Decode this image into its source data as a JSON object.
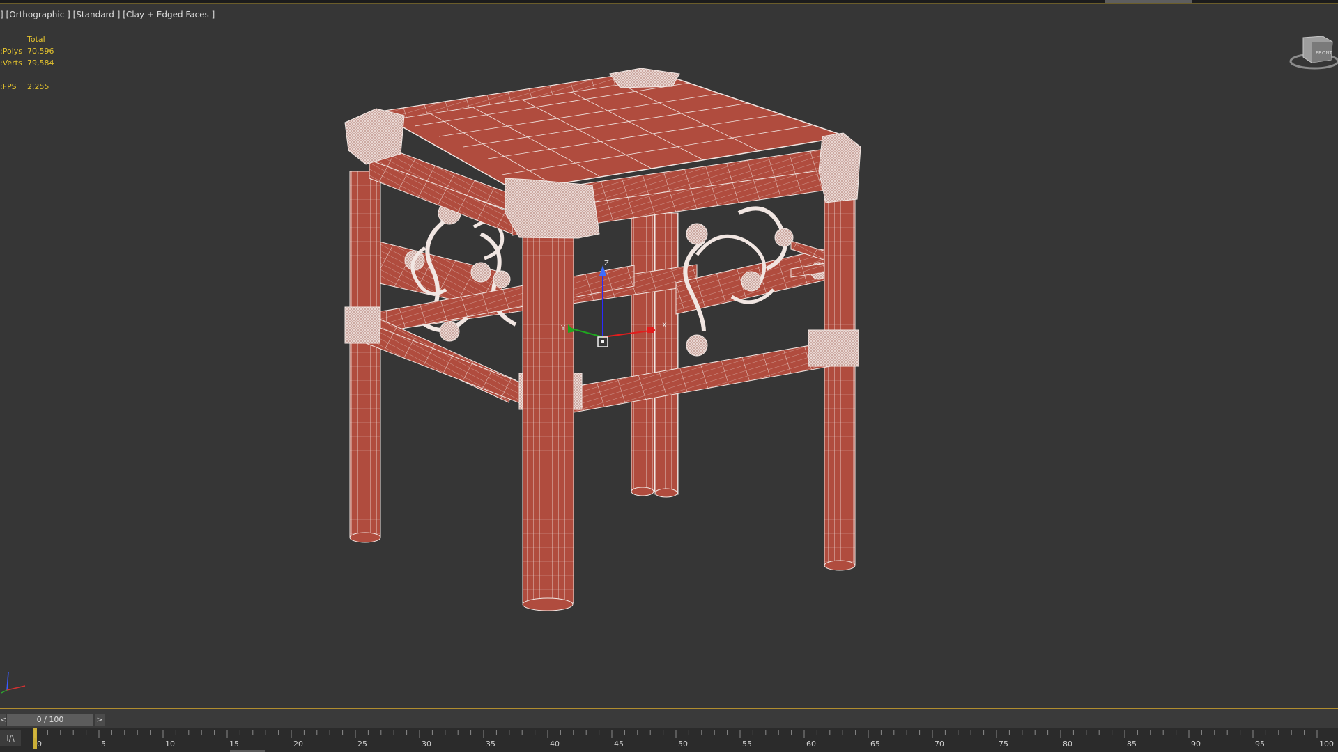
{
  "viewport": {
    "label_parts": [
      "]",
      "[Orthographic ]",
      "[Standard ]",
      "[Clay + Edged Faces ]"
    ],
    "stats": {
      "header": "Total",
      "rows": [
        {
          "key": "Polys:",
          "value": "70,596"
        },
        {
          "key": "Verts:",
          "value": "79,584"
        }
      ],
      "fps_key": "FPS:",
      "fps_value": "2.255"
    },
    "viewcube_label": "FRONT",
    "gizmo_labels": {
      "x": "X",
      "y": "Y",
      "z": "Z"
    }
  },
  "timeline": {
    "prev_label": "<",
    "slider_text": "0 / 100",
    "next_label": ">",
    "current_frame": 0,
    "total_frames": 100,
    "tick_labels": [
      "0",
      "5",
      "10",
      "15",
      "20",
      "25",
      "30",
      "35",
      "40",
      "45",
      "50",
      "55",
      "60",
      "65",
      "70",
      "75",
      "80",
      "85",
      "90",
      "95",
      "100"
    ],
    "curve_button": "I/\\"
  },
  "colors": {
    "background": "#363636",
    "model_fill": "#b04c3e",
    "wire": "#f1e6e2",
    "stats_text": "#e3c22e"
  }
}
